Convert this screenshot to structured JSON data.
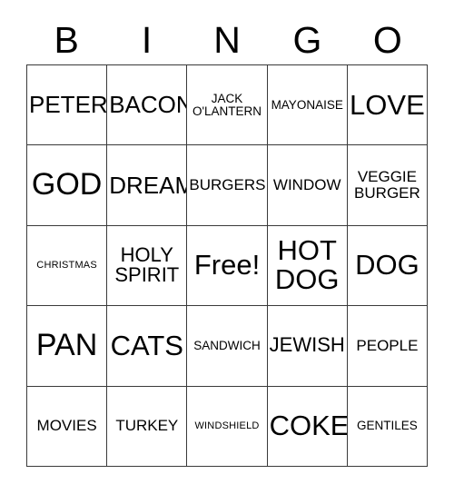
{
  "card": {
    "header": {
      "letters": [
        "B",
        "I",
        "N",
        "G",
        "O"
      ]
    },
    "rows": [
      [
        {
          "text": "PETER",
          "size": "xl"
        },
        {
          "text": "BACON",
          "size": "xl"
        },
        {
          "text": "JACK\nO'LANTERN",
          "size": "s"
        },
        {
          "text": "MAYONAISE",
          "size": "s"
        },
        {
          "text": "LOVE",
          "size": "xxl"
        }
      ],
      [
        {
          "text": "GOD",
          "size": "xxxl"
        },
        {
          "text": "DREAM",
          "size": "xl"
        },
        {
          "text": "BURGERS",
          "size": "m"
        },
        {
          "text": "WINDOW",
          "size": "m"
        },
        {
          "text": "VEGGIE\nBURGER",
          "size": "m"
        }
      ],
      [
        {
          "text": "CHRISTMAS",
          "size": "xs"
        },
        {
          "text": "HOLY\nSPIRIT",
          "size": "l"
        },
        {
          "text": "Free!",
          "size": "xxl"
        },
        {
          "text": "HOT\nDOG",
          "size": "xxl"
        },
        {
          "text": "DOG",
          "size": "xxl"
        }
      ],
      [
        {
          "text": "PAN",
          "size": "xxxl"
        },
        {
          "text": "CATS",
          "size": "xxl"
        },
        {
          "text": "SANDWICH",
          "size": "s"
        },
        {
          "text": "JEWISH",
          "size": "l"
        },
        {
          "text": "PEOPLE",
          "size": "m"
        }
      ],
      [
        {
          "text": "MOVIES",
          "size": "m"
        },
        {
          "text": "TURKEY",
          "size": "m"
        },
        {
          "text": "WINDSHIELD",
          "size": "xs"
        },
        {
          "text": "COKE",
          "size": "xxl"
        },
        {
          "text": "GENTILES",
          "size": "s"
        }
      ]
    ],
    "colors": {
      "border": "#3a3a3a",
      "text": "#000000",
      "background": "#ffffff"
    }
  }
}
